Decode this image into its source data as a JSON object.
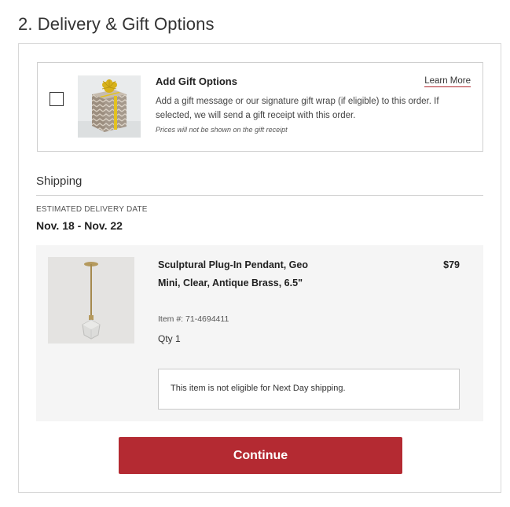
{
  "section": {
    "title": "2. Delivery & Gift Options"
  },
  "gift": {
    "checked": false,
    "image_icon": "gift-box-image",
    "title": "Add Gift Options",
    "learn_more": "Learn More",
    "description": "Add a gift message or our signature gift wrap (if eligible) to this order. If selected, we will send a gift receipt with this order.",
    "note": "Prices will not be shown on the gift receipt"
  },
  "shipping": {
    "heading": "Shipping",
    "estimated_label": "ESTIMATED DELIVERY DATE",
    "estimated_date": "Nov. 18 - Nov. 22"
  },
  "item": {
    "name": "Sculptural Plug-In Pendant, Geo Mini, Clear, Antique Brass, 6.5\"",
    "price": "$79",
    "item_number": "Item #: 71-4694411",
    "qty": "Qty 1",
    "eligibility": "This item is not eligible for Next Day shipping."
  },
  "actions": {
    "continue_label": "Continue"
  },
  "colors": {
    "accent": "#b42a32",
    "panel_border": "#d8d8d8",
    "item_bg": "#f5f5f5"
  }
}
